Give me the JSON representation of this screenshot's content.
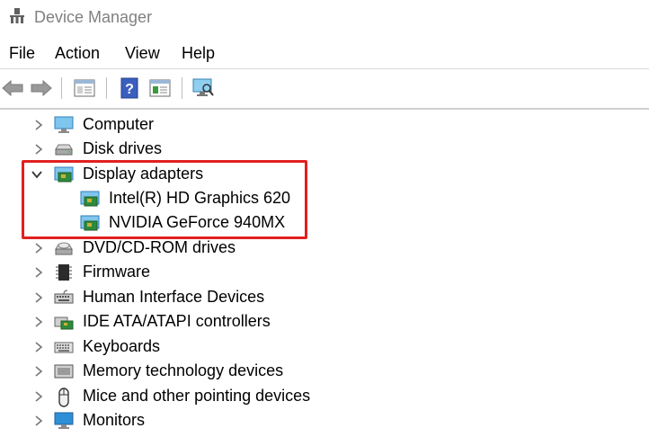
{
  "window": {
    "title": "Device Manager"
  },
  "menu": {
    "file": "File",
    "action": "Action",
    "view": "View",
    "help": "Help"
  },
  "toolbar": [
    "back-arrow-icon",
    "forward-arrow-icon",
    "properties-icon",
    "help-icon",
    "update-driver-icon",
    "scan-hardware-icon"
  ],
  "tree": {
    "computer": "Computer",
    "disk_drives": "Disk drives",
    "display_adapters": "Display adapters",
    "intel": "Intel(R) HD Graphics 620",
    "nvidia": "NVIDIA GeForce 940MX",
    "dvd": "DVD/CD-ROM drives",
    "firmware": "Firmware",
    "hid": "Human Interface Devices",
    "ide": "IDE ATA/ATAPI controllers",
    "keyboards": "Keyboards",
    "memory": "Memory technology devices",
    "mice": "Mice and other pointing devices",
    "monitors": "Monitors"
  },
  "colors": {
    "highlight": "#e02020",
    "monitor_blue": "#2f8fd6"
  }
}
